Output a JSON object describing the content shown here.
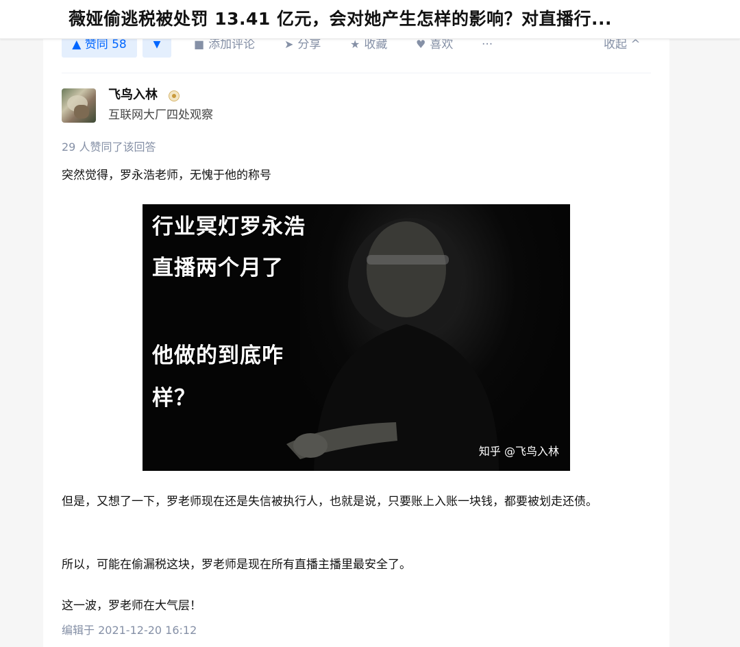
{
  "page": {
    "title": "薇娅偷逃税被处罚 13.41 亿元，会对她产生怎样的影响？对直播行..."
  },
  "actions": {
    "vote_up": "▲ 赞同 58",
    "vote_down": "▼",
    "comment": "添加评论",
    "share": "分享",
    "favorite": "收藏",
    "like": "喜欢",
    "more": "···",
    "collapse": "收起 ^"
  },
  "author": {
    "name": "飞鸟入林",
    "headline": "互联网大厂四处观察"
  },
  "answer": {
    "votes_info": "29 人赞同了该回答",
    "paragraph_1": "突然觉得，罗永浩老师，无愧于他的称号",
    "image": {
      "caption_1": "行业冥灯罗永浩",
      "caption_2": "直播两个月了",
      "caption_3": "他做的到底咋",
      "caption_4": "样？",
      "watermark": "知乎 @飞鸟入林"
    },
    "paragraph_2": "但是，又想了一下，罗老师现在还是失信被执行人，也就是说，只要账上入账一块钱，都要被划走还债。",
    "paragraph_3": "所以，可能在偷漏税这块，罗老师是现在所有直播主播里最安全了。",
    "paragraph_4": "这一波，罗老师在大气层！",
    "edited": "编辑于 2021-12-20 16:12"
  },
  "colors": {
    "accent": "#0066ff",
    "vote_bg": "#e4effd",
    "muted": "#8590a6"
  }
}
